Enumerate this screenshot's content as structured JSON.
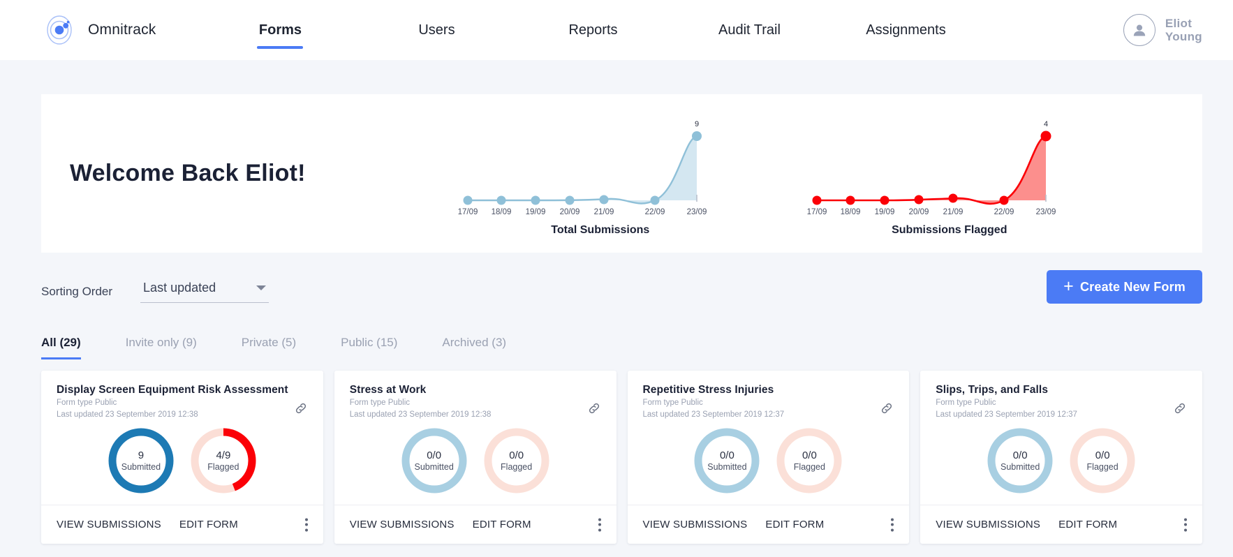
{
  "nav": {
    "brand": "Omnitrack",
    "logo_icon": "atom-logo-icon",
    "links": [
      {
        "label": "Forms",
        "active": true
      },
      {
        "label": "Users",
        "active": false
      },
      {
        "label": "Reports",
        "active": false
      },
      {
        "label": "Audit Trail",
        "active": false
      },
      {
        "label": "Assignments",
        "active": false
      }
    ],
    "user_name": "Eliot\nYoung",
    "avatar_icon": "user-avatar-icon"
  },
  "panel": {
    "welcome": "Welcome Back Eliot!"
  },
  "chart_data": [
    {
      "type": "area",
      "title": "Total Submissions",
      "categories": [
        "17/09",
        "18/09",
        "19/09",
        "20/09",
        "21/09",
        "22/09",
        "23/09"
      ],
      "values": [
        0,
        0,
        0,
        0,
        0,
        0,
        9
      ],
      "point_labels": [
        "",
        "",
        "",
        "",
        "",
        "",
        "9"
      ],
      "xlabel": "",
      "ylabel": "",
      "ylim": [
        0,
        9
      ],
      "grid": false,
      "legend": "none",
      "color": "#8fc0d8",
      "fill": "#cde3ef"
    },
    {
      "type": "area",
      "title": "Submissions Flagged",
      "categories": [
        "17/09",
        "18/09",
        "19/09",
        "20/09",
        "21/09",
        "22/09",
        "23/09"
      ],
      "values": [
        0,
        0,
        0,
        0,
        0,
        0,
        4
      ],
      "point_labels": [
        "",
        "",
        "",
        "",
        "",
        "",
        "4"
      ],
      "xlabel": "",
      "ylabel": "",
      "ylim": [
        0,
        4
      ],
      "grid": false,
      "legend": "none",
      "color": "#fb0007",
      "fill": "#fb7b79"
    }
  ],
  "sorting": {
    "label": "Sorting Order",
    "selected": "Last updated",
    "caret_icon": "chevron-down-icon"
  },
  "create_button": {
    "label": "Create New Form",
    "plus_icon": "plus-icon",
    "color": "#4b7bf5"
  },
  "tabs": [
    {
      "label": "All (29)",
      "active": true
    },
    {
      "label": "Invite only (9)",
      "active": false
    },
    {
      "label": "Private (5)",
      "active": false
    },
    {
      "label": "Public (15)",
      "active": false
    },
    {
      "label": "Archived (3)",
      "active": false
    }
  ],
  "card_actions": {
    "view": "VIEW SUBMISSIONS",
    "edit": "EDIT FORM",
    "link_icon": "link-chain-icon",
    "menu_icon": "kebab-menu-icon"
  },
  "cards": [
    {
      "title": "Display Screen Equipment Risk Assessment",
      "form_type": "Form type Public",
      "last_updated": "Last updated 23 September 2019 12:38",
      "submitted_value": "9",
      "submitted_label": "Submitted",
      "submitted_pct": 100,
      "flagged_value": "4/9",
      "flagged_label": "Flagged",
      "flagged_pct": 44,
      "submitted_color": "#1d7ab4",
      "flagged_color": "#fb0007"
    },
    {
      "title": "Stress at Work",
      "form_type": "Form type Public",
      "last_updated": "Last updated 23 September 2019 12:38",
      "submitted_value": "0/0",
      "submitted_label": "Submitted",
      "submitted_pct": 0,
      "flagged_value": "0/0",
      "flagged_label": "Flagged",
      "flagged_pct": 0,
      "submitted_color": "#a8cfe2",
      "flagged_color": "#fbe0d8"
    },
    {
      "title": "Repetitive Stress Injuries",
      "form_type": "Form type Public",
      "last_updated": "Last updated 23 September 2019 12:37",
      "submitted_value": "0/0",
      "submitted_label": "Submitted",
      "submitted_pct": 0,
      "flagged_value": "0/0",
      "flagged_label": "Flagged",
      "flagged_pct": 0,
      "submitted_color": "#a8cfe2",
      "flagged_color": "#fbe0d8"
    },
    {
      "title": "Slips, Trips, and Falls",
      "form_type": "Form type Public",
      "last_updated": "Last updated 23 September 2019 12:37",
      "submitted_value": "0/0",
      "submitted_label": "Submitted",
      "submitted_pct": 0,
      "flagged_value": "0/0",
      "flagged_label": "Flagged",
      "flagged_pct": 0,
      "submitted_color": "#a8cfe2",
      "flagged_color": "#fbe0d8"
    }
  ]
}
